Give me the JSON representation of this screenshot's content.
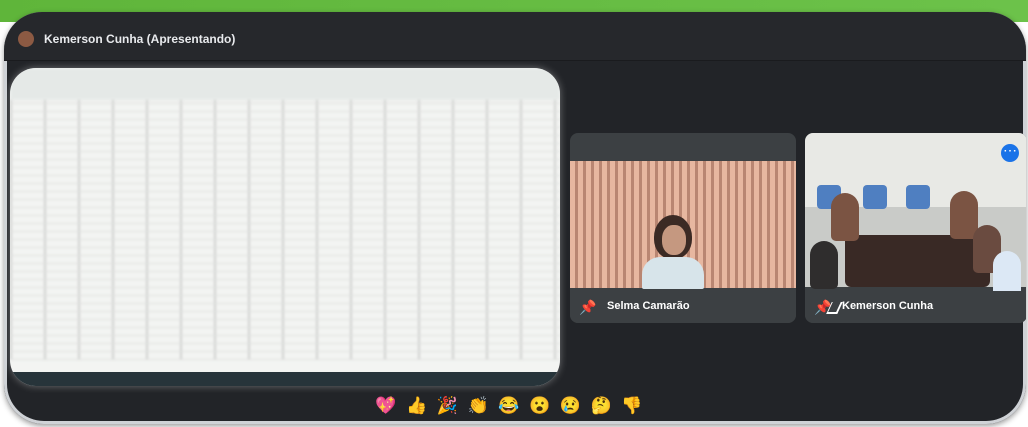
{
  "header": {
    "presenter_label": "Kemerson Cunha (Apresentando)"
  },
  "participants": [
    {
      "name": "Selma Camarão"
    },
    {
      "name": "Kemerson Cunha"
    }
  ],
  "reactions": [
    "💖",
    "👍",
    "🎉",
    "👏",
    "😂",
    "😮",
    "😢",
    "🤔",
    "👎"
  ],
  "colors": {
    "accent_green": "#6cc24a",
    "frame_dark": "#222428",
    "tile_gray": "#3c4043",
    "more_blue": "#1a73e8"
  }
}
